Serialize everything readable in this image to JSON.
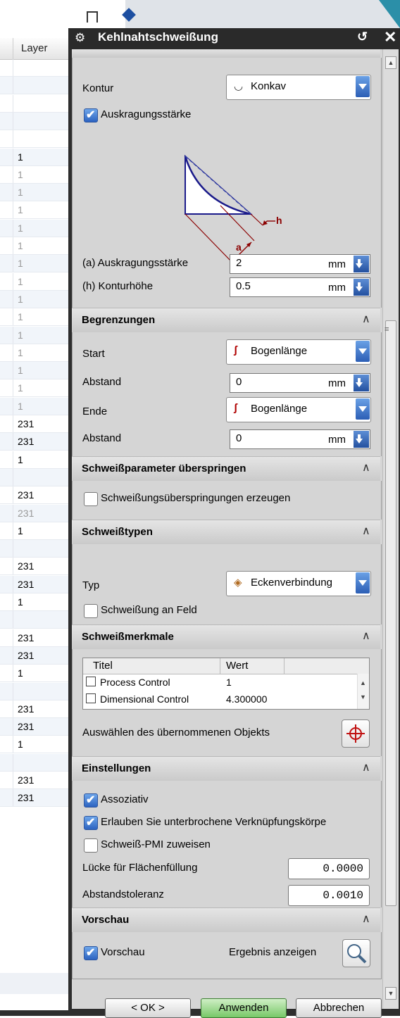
{
  "background_table": {
    "header": "Layer",
    "rows": [
      {
        "value": ""
      },
      {
        "value": ""
      },
      {
        "value": ""
      },
      {
        "value": ""
      },
      {
        "value": ""
      },
      {
        "value": "1",
        "dim": false
      },
      {
        "value": "1",
        "dim": true
      },
      {
        "value": "1",
        "dim": true
      },
      {
        "value": "1",
        "dim": true
      },
      {
        "value": "1",
        "dim": true
      },
      {
        "value": "1",
        "dim": true
      },
      {
        "value": "1",
        "dim": true
      },
      {
        "value": "1",
        "dim": true
      },
      {
        "value": "1",
        "dim": true
      },
      {
        "value": "1",
        "dim": true
      },
      {
        "value": "1",
        "dim": true
      },
      {
        "value": "1",
        "dim": true
      },
      {
        "value": "1",
        "dim": true
      },
      {
        "value": "1",
        "dim": true
      },
      {
        "value": "1",
        "dim": true
      },
      {
        "value": "231",
        "dim": false
      },
      {
        "value": "231",
        "dim": false
      },
      {
        "value": "1",
        "dim": false
      },
      {
        "value": ""
      },
      {
        "value": "231",
        "dim": false
      },
      {
        "value": "231",
        "dim": true
      },
      {
        "value": "1",
        "dim": false
      },
      {
        "value": ""
      },
      {
        "value": "231",
        "dim": false
      },
      {
        "value": "231",
        "dim": false
      },
      {
        "value": "1",
        "dim": false
      },
      {
        "value": ""
      },
      {
        "value": "231",
        "dim": false
      },
      {
        "value": "231",
        "dim": false
      },
      {
        "value": "1",
        "dim": false
      },
      {
        "value": ""
      },
      {
        "value": "231",
        "dim": false
      },
      {
        "value": "231",
        "dim": false
      },
      {
        "value": "1",
        "dim": false
      },
      {
        "value": ""
      },
      {
        "value": "231",
        "dim": false
      },
      {
        "value": "231",
        "dim": false
      }
    ]
  },
  "dialog": {
    "title": "Kehlnahtschweißung",
    "sections": {
      "querschnitt": {
        "kontur_label": "Kontur",
        "kontur_value": "Konkav",
        "auskragung_checkbox_label": "Auskragungsstärke",
        "auskragung_checked": true,
        "diagram_label_h": "h",
        "diagram_label_a": "a",
        "a_label": "(a) Auskragungsstärke",
        "a_value": "2",
        "a_unit": "mm",
        "h_label": "(h) Konturhöhe",
        "h_value": "0.5",
        "h_unit": "mm"
      },
      "begrenzungen": {
        "title": "Begrenzungen",
        "start_label": "Start",
        "start_value": "Bogenlänge",
        "abstand1_label": "Abstand",
        "abstand1_value": "0",
        "abstand1_unit": "mm",
        "ende_label": "Ende",
        "ende_value": "Bogenlänge",
        "abstand2_label": "Abstand",
        "abstand2_value": "0",
        "abstand2_unit": "mm"
      },
      "skip": {
        "title": "Schweißparameter überspringen",
        "checkbox_label": "Schweißungsüberspringungen erzeugen",
        "checked": false
      },
      "typen": {
        "title": "Schweißtypen",
        "typ_label": "Typ",
        "typ_value": "Eckenverbindung",
        "feld_label": "Schweißung an Feld",
        "feld_checked": false
      },
      "merkmale": {
        "title": "Schweißmerkmale",
        "columns": [
          "Titel",
          "Wert"
        ],
        "rows": [
          {
            "titel": "Process Control",
            "wert": "1"
          },
          {
            "titel": "Dimensional Control",
            "wert": "4.300000"
          }
        ],
        "select_label": "Auswählen des übernommenen Objekts"
      },
      "einstellungen": {
        "title": "Einstellungen",
        "assoziativ_label": "Assoziativ",
        "assoziativ_checked": true,
        "erlauben_label": "Erlauben Sie unterbrochene Verknüpfungskörpe",
        "erlauben_checked": true,
        "pmi_label": "Schweiß-PMI zuweisen",
        "pmi_checked": false,
        "luecke_label": "Lücke für Flächenfüllung",
        "luecke_value": "0.0000",
        "toleranz_label": "Abstandstoleranz",
        "toleranz_value": "0.0010"
      },
      "vorschau": {
        "title": "Vorschau",
        "checkbox_label": "Vorschau",
        "checked": true,
        "result_label": "Ergebnis anzeigen"
      }
    },
    "buttons": {
      "ok": "< OK >",
      "apply": "Anwenden",
      "cancel": "Abbrechen"
    }
  },
  "colors": {
    "accent_blue": "#2c5eb5",
    "apply_green": "#78c868",
    "diagram_red": "#8b0000",
    "diagram_navy": "#1a1a8a"
  }
}
